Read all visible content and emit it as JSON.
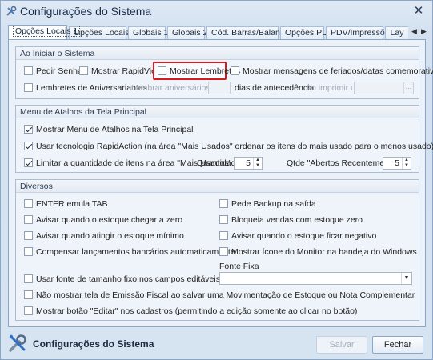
{
  "window": {
    "title": "Configurações do Sistema",
    "close_glyph": "✕"
  },
  "tabs": [
    {
      "label": "Opções Locais 1",
      "active": true
    },
    {
      "label": "Opções Locais 2"
    },
    {
      "label": "Globais 1"
    },
    {
      "label": "Globais 2"
    },
    {
      "label": "Cód. Barras/Balança"
    },
    {
      "label": "Opções PDV"
    },
    {
      "label": "PDV/Impressões"
    },
    {
      "label": "Lay"
    }
  ],
  "tab_nav": {
    "prev": "◀",
    "next": "▶"
  },
  "ao_iniciar": {
    "header": "Ao Iniciar o Sistema",
    "pedir_senha": {
      "label": "Pedir Senha",
      "checked": false
    },
    "mostrar_rapidview": {
      "label": "Mostrar RapidView",
      "checked": false
    },
    "mostrar_lembretes": {
      "label": "Mostrar Lembretes",
      "checked": false
    },
    "mostrar_feriados": {
      "label": "Mostrar mensagens de feriados/datas comemorativas",
      "checked": false
    },
    "lembretes_aniversariantes": {
      "label": "Lembretes de Aniversariantes",
      "checked": false
    },
    "lembrar_aniversarios_label": "Lembrar aniversários com",
    "dias_antecedencia_label": "dias de antecedência",
    "ao_imprimir_usar_label": "Ao imprimir usar",
    "ellipsis": "…"
  },
  "atalhos": {
    "header": "Menu de Atalhos da Tela Principal",
    "mostrar_menu": {
      "label": "Mostrar Menu de Atalhos na Tela Principal",
      "checked": true
    },
    "usar_rapidaction": {
      "label": "Usar tecnologia RapidAction (na área \"Mais Usados\" ordenar os itens do mais usado para o menos usado)",
      "checked": true
    },
    "limitar_quantidade": {
      "label": "Limitar a quantidade de itens na área \"Mais Usados\"",
      "checked": true
    },
    "quantidade_label": "Quantidade",
    "quantidade_value": "5",
    "qtde_abertos_label": "Qtde \"Abertos Recentemente\"",
    "qtde_abertos_value": "5",
    "spin_up": "▲",
    "spin_down": "▼"
  },
  "diversos": {
    "header": "Diversos",
    "enter_tab": {
      "label": "ENTER emula TAB",
      "checked": false
    },
    "pede_backup": {
      "label": "Pede Backup na saída",
      "checked": false
    },
    "avisar_estoque_zero": {
      "label": "Avisar quando o estoque chegar a zero",
      "checked": false
    },
    "bloqueia_vendas": {
      "label": "Bloqueia vendas com estoque zero",
      "checked": false
    },
    "avisar_estoque_minimo": {
      "label": "Avisar quando atingir o estoque mínimo",
      "checked": false
    },
    "avisar_estoque_negativo": {
      "label": "Avisar quando o estoque ficar negativo",
      "checked": false
    },
    "compensar_lancamentos": {
      "label": "Compensar lançamentos bancários automaticamente",
      "checked": false
    },
    "mostrar_icone_monitor": {
      "label": "Mostrar ícone do Monitor na bandeja do Windows",
      "checked": false
    },
    "fonte_fixa_label": "Fonte Fixa",
    "usar_fonte_fixa": {
      "label": "Usar fonte de tamanho fixo nos campos editáveis",
      "checked": false
    },
    "nao_mostrar_emissao": {
      "label": "Não mostrar tela de Emissão Fiscal ao salvar uma Movimentação de Estoque ou Nota Complementar",
      "checked": false
    },
    "mostrar_botao_editar": {
      "label": "Mostrar botão \"Editar\" nos cadastros (permitindo a edição somente ao clicar no botão)",
      "checked": false
    },
    "dropdown_arrow": "▼"
  },
  "footer": {
    "title": "Configurações do Sistema",
    "salvar": "Salvar",
    "fechar": "Fechar"
  },
  "colors": {
    "highlight": "#d61c1c",
    "window_bg": "#d6e3f1"
  }
}
